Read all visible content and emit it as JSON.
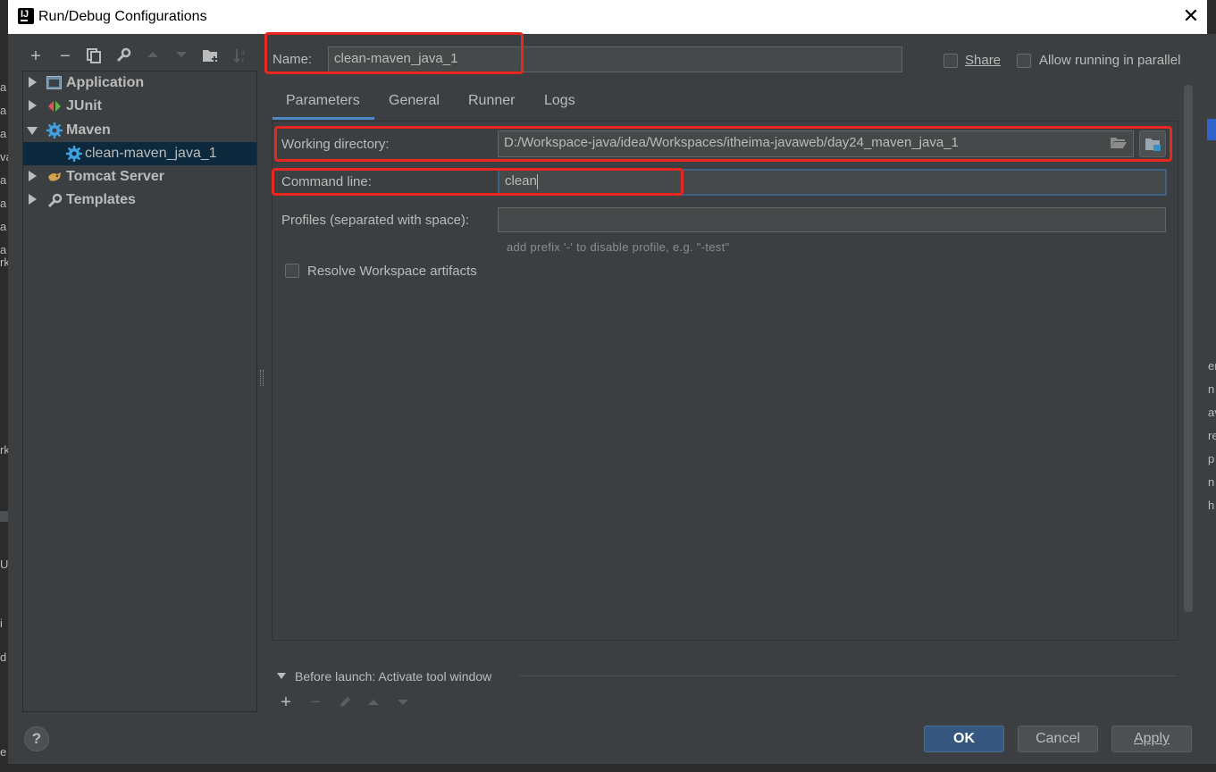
{
  "window": {
    "title": "Run/Debug Configurations"
  },
  "toolbar": {
    "add": "+",
    "remove": "−"
  },
  "tree": {
    "items": [
      {
        "label": "Application"
      },
      {
        "label": "JUnit"
      },
      {
        "label": "Maven"
      },
      {
        "label": "clean-maven_java_1"
      },
      {
        "label": "Tomcat Server"
      },
      {
        "label": "Templates"
      }
    ]
  },
  "form": {
    "name_label": "Name:",
    "name_value": "clean-maven_java_1",
    "share_label": "Share",
    "parallel_label": "Allow running in parallel",
    "tabs": [
      "Parameters",
      "General",
      "Runner",
      "Logs"
    ],
    "working_dir_label": "Working directory:",
    "working_dir_value": "D:/Workspace-java/idea/Workspaces/itheima-javaweb/day24_maven_java_1",
    "command_line_label": "Command line:",
    "command_line_value": "clean",
    "profiles_label": "Profiles (separated with space):",
    "profiles_value": "",
    "profiles_hint": "add prefix '-' to disable profile, e.g. \"-test\"",
    "resolve_label": "Resolve Workspace artifacts"
  },
  "before_launch": {
    "label": "Before launch: Activate tool window",
    "add": "+",
    "remove": "−"
  },
  "buttons": {
    "ok": "OK",
    "cancel": "Cancel",
    "apply": "Apply",
    "help": "?"
  },
  "background_fragments": {
    "left": [
      "a",
      "a",
      "a",
      "va",
      "a",
      "a",
      "a",
      "a",
      "rk",
      "rk",
      "U",
      "i",
      "d",
      "e"
    ],
    "right": [
      "er",
      "n",
      "av",
      "re",
      "p",
      "n",
      "h"
    ]
  }
}
